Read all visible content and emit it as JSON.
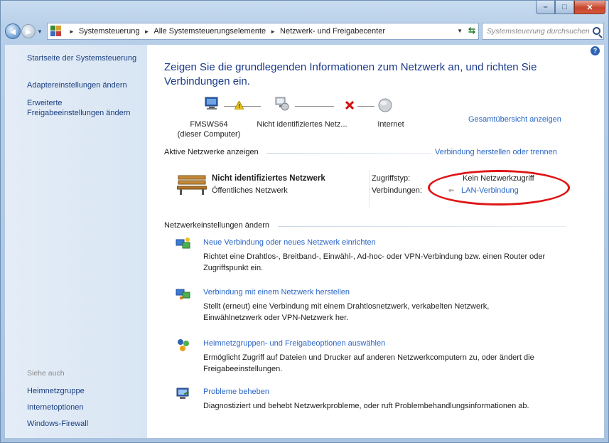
{
  "window": {
    "caption_buttons": {
      "minimize": "–",
      "maximize": "□",
      "close": "✕"
    }
  },
  "address_bar": {
    "crumbs": [
      "Systemsteuerung",
      "Alle Systemsteuerungselemente",
      "Netzwerk- und Freigabecenter"
    ],
    "search_placeholder": "Systemsteuerung durchsuchen"
  },
  "left_pane": {
    "links": [
      "Startseite der Systemsteuerung",
      "Adaptereinstellungen ändern",
      "Erweiterte",
      "Freigabeeinstellungen ändern"
    ],
    "see_also_label": "Siehe auch",
    "see_also": [
      "Heimnetzgruppe",
      "Internetoptionen",
      "Windows-Firewall"
    ]
  },
  "main": {
    "help_icon": "?",
    "heading_line1": "Zeigen Sie die grundlegenden Informationen zum Netzwerk an, und richten Sie",
    "heading_line2": "Verbindungen ein.",
    "full_map_link": "Gesamtübersicht anzeigen",
    "map": {
      "computer_name": "FMSWS64",
      "computer_sub": "(dieser Computer)",
      "network_label": "Nicht identifiziertes Netz...",
      "internet_label": "Internet"
    },
    "active_networks_title": "Aktive Netzwerke anzeigen",
    "connect_link": "Verbindung herstellen oder trennen",
    "network": {
      "name": "Nicht identifiziertes Netzwerk",
      "type": "Öffentliches Netzwerk",
      "access_type_label": "Zugriffstyp:",
      "access_type_value": "Kein Netzwerkzugriff",
      "connections_label": "Verbindungen:",
      "connection_value": "LAN-Verbindung"
    },
    "settings_title": "Netzwerkeinstellungen ändern",
    "tasks": [
      {
        "title": "Neue Verbindung oder neues Netzwerk einrichten",
        "desc1": "Richtet eine Drahtlos-, Breitband-, Einwähl-, Ad-hoc- oder VPN-Verbindung bzw. einen Router oder",
        "desc2": "Zugriffspunkt ein."
      },
      {
        "title": "Verbindung mit einem Netzwerk herstellen",
        "desc1": "Stellt (erneut) eine Verbindung mit einem Drahtlosnetzwerk, verkabelten Netzwerk,",
        "desc2": "Einwählnetzwerk oder VPN-Netzwerk her."
      },
      {
        "title": "Heimnetzgruppen- und Freigabeoptionen auswählen",
        "desc1": "Ermöglicht Zugriff auf Dateien und Drucker auf anderen Netzwerkcomputern zu, oder ändert die",
        "desc2": "Freigabeeinstellungen."
      },
      {
        "title": "Probleme beheben",
        "desc1": "Diagnostiziert und behebt Netzwerkprobleme, oder ruft Problembehandlungsinformationen ab.",
        "desc2": ""
      }
    ]
  },
  "colors": {
    "link": "#2a66c7",
    "heading": "#1a3a8a",
    "annotation": "#e01515",
    "warning": "#e8c21a",
    "error": "#d01010"
  }
}
